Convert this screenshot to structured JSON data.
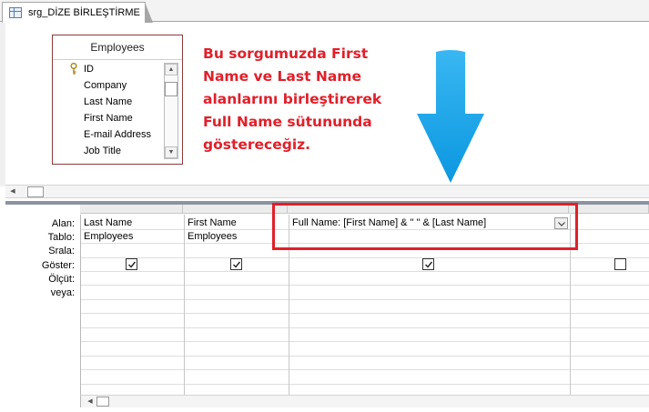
{
  "tab": {
    "title": "srg_DİZE BİRLEŞTİRME",
    "icon": "query-icon"
  },
  "table": {
    "name": "Employees",
    "fields": [
      "ID",
      "Company",
      "Last Name",
      "First Name",
      "E-mail Address",
      "Job Title"
    ],
    "primary_key_icon": "key-icon"
  },
  "annotation": "Bu sorgumuzda First Name ve Last Name alanlarını birleştirerek Full Name sütununda göstereceğiz.",
  "colors": {
    "annotation": "#e0202a",
    "arrow": "#0ea2e8",
    "highlight": "#e0202a"
  },
  "grid": {
    "row_labels": {
      "field": "Alan:",
      "table": "Tablo:",
      "sort": "Srala:",
      "show": "Göster:",
      "criteria": "Ölçüt:",
      "or": "veya:"
    },
    "columns": [
      {
        "field": "Last Name",
        "table": "Employees",
        "show": true
      },
      {
        "field": "First Name",
        "table": "Employees",
        "show": true
      },
      {
        "field": "Full Name: [First Name] & \" \" & [Last Name]",
        "table": "",
        "show": true
      },
      {
        "field": "",
        "table": "",
        "show": false
      }
    ]
  }
}
